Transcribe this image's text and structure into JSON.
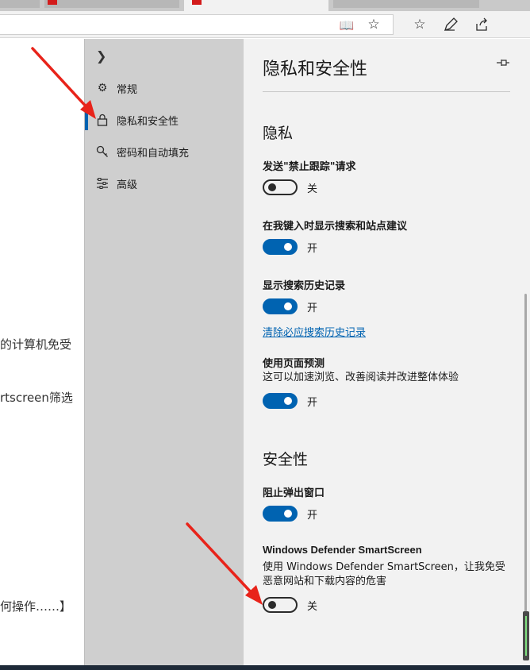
{
  "toolbar": {
    "icons": [
      "reading-view-icon",
      "favorite-star-icon",
      "favorites-list-icon",
      "pen-icon",
      "share-icon"
    ]
  },
  "page_bg": {
    "lines": [
      "的计算机免受",
      "rtscreen筛选",
      "何操作……】"
    ]
  },
  "nav": {
    "items": [
      {
        "label": "常规",
        "icon": "gear-icon"
      },
      {
        "label": "隐私和安全性",
        "icon": "lock-icon"
      },
      {
        "label": "密码和自动填充",
        "icon": "key-icon"
      },
      {
        "label": "高级",
        "icon": "sliders-icon"
      }
    ],
    "selected_index": 1
  },
  "pane": {
    "title": "隐私和安全性",
    "privacy": {
      "heading": "隐私",
      "dnt": {
        "label": "发送\"禁止跟踪\"请求",
        "state": "关",
        "on": false
      },
      "suggestions": {
        "label": "在我键入时显示搜索和站点建议",
        "state": "开",
        "on": true
      },
      "history": {
        "label": "显示搜索历史记录",
        "state": "开",
        "on": true,
        "link": "清除必应搜索历史记录"
      },
      "prediction": {
        "label": "使用页面预测",
        "desc": "这可以加速浏览、改善阅读并改进整体体验",
        "state": "开",
        "on": true
      }
    },
    "security": {
      "heading": "安全性",
      "popups": {
        "label": "阻止弹出窗口",
        "state": "开",
        "on": true
      },
      "smartscreen": {
        "label": "Windows Defender SmartScreen",
        "desc": "使用 Windows Defender SmartScreen，让我免受恶意网站和下载内容的危害",
        "state": "关",
        "on": false
      }
    }
  },
  "colors": {
    "accent": "#0063b1",
    "annotation": "#e8231a"
  }
}
